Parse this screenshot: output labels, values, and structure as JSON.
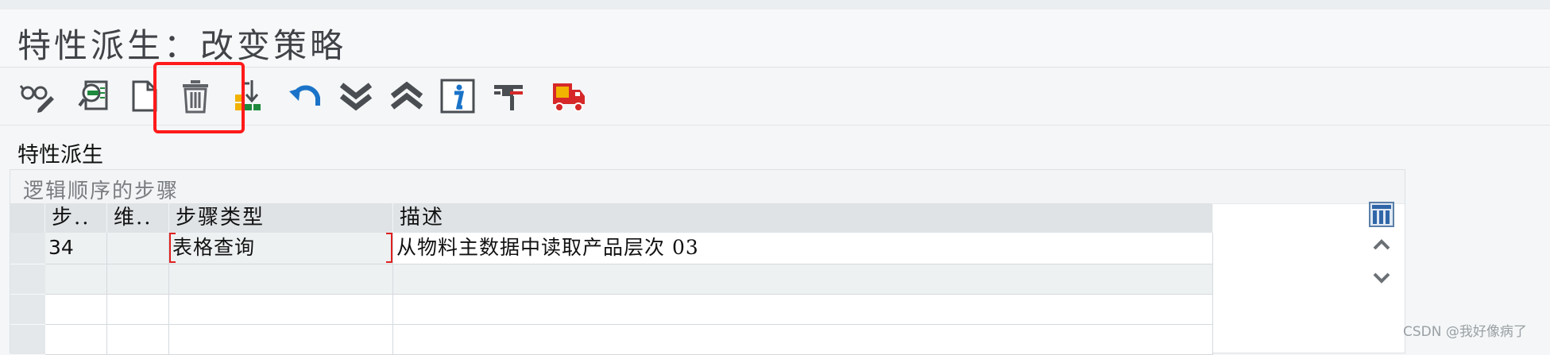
{
  "title": "特性派生：改变策略",
  "toolbar": {
    "buttons": [
      {
        "name": "display-change-icon"
      },
      {
        "name": "find-icon"
      },
      {
        "name": "new-document-icon"
      },
      {
        "name": "delete-icon"
      },
      {
        "name": "sort-icon"
      },
      {
        "name": "undo-icon"
      },
      {
        "name": "expand-all-icon"
      },
      {
        "name": "collapse-all-icon"
      },
      {
        "name": "info-icon"
      },
      {
        "name": "paragraph-icon"
      },
      {
        "name": "transport-icon"
      }
    ]
  },
  "section_label": "特性派生",
  "panel": {
    "title": "逻辑顺序的步骤",
    "columns": [
      "步..",
      "维..",
      "步骤类型",
      "描述"
    ],
    "rows": [
      {
        "step": "34",
        "dim": "",
        "type": "表格查询",
        "description": "从物料主数据中读取产品层次 03"
      },
      {
        "step": "",
        "dim": "",
        "type": "",
        "description": ""
      },
      {
        "step": "",
        "dim": "",
        "type": "",
        "description": ""
      },
      {
        "step": "",
        "dim": "",
        "type": "",
        "description": ""
      }
    ]
  },
  "side_tools": [
    {
      "name": "table-settings-icon"
    },
    {
      "name": "scroll-up-icon"
    },
    {
      "name": "scroll-down-icon"
    }
  ],
  "watermark": "CSDN @我好像病了",
  "colors": {
    "highlight": "#ff1a1a",
    "undo_blue": "#1a73c8",
    "info_blue": "#1a73c8",
    "delete_grey": "#5f6368"
  }
}
